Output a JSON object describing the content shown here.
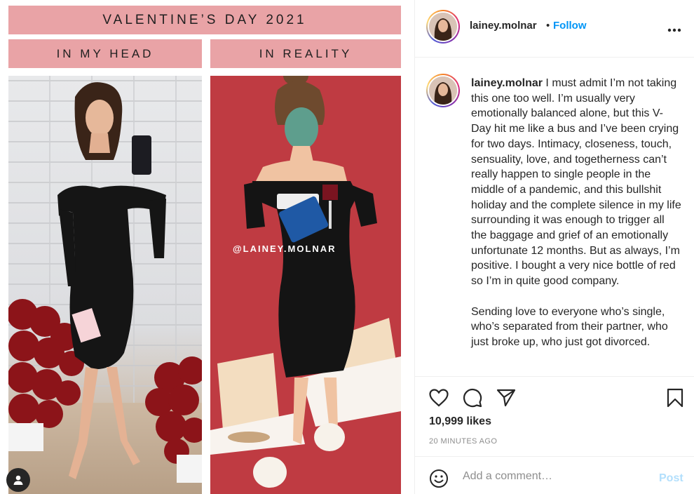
{
  "post_image": {
    "banner_title": "VALENTINE’S DAY 2021",
    "label_left": "IN MY HEAD",
    "label_right": "IN REALITY",
    "watermark": "@LAINEY.MOLNAR",
    "colors": {
      "banner": "#e9a3a6",
      "art_background": "#bf3b42"
    }
  },
  "header": {
    "username": "lainey.molnar",
    "separator": "•",
    "follow_label": "Follow",
    "more_icon": "more-options-icon"
  },
  "caption": {
    "username": "lainey.molnar",
    "paragraphs": [
      "I must admit I’m not taking this one too well. I’m usually very emotionally balanced alone, but this V-Day hit me like a bus and I’ve been crying for two days. Intimacy, closeness, touch, sensuality, love, and togetherness can’t really happen to single people in the middle of a pandemic, and this bullshit holiday and the complete silence in my life surrounding it was enough to trigger all the baggage and grief of an emotionally unfortunate 12 months. But as always, I’m positive. I bought a very nice bottle of red so I’m in quite good company.",
      "Sending love to everyone who’s single, who’s separated from their partner, who just broke up, who just got divorced."
    ]
  },
  "actions": {
    "likes": "10,999 likes",
    "time_ago": "20 MINUTES AGO"
  },
  "comment": {
    "placeholder": "Add a comment…",
    "post_label": "Post"
  },
  "colors": {
    "link_blue": "#0095f6",
    "post_disabled": "#b2dffc",
    "text": "#262626",
    "muted": "#8e8e8e"
  }
}
